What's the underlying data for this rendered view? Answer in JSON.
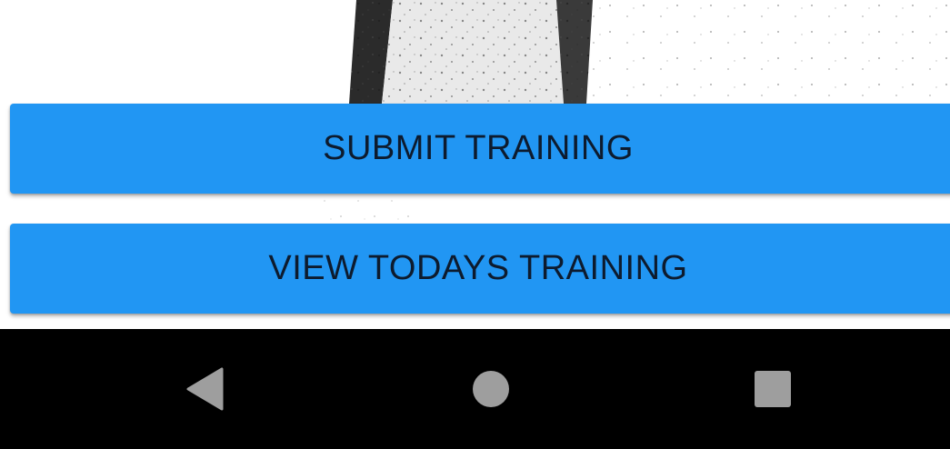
{
  "buttons": {
    "submit_training": "SUBMIT TRAINING",
    "view_todays_training": "VIEW TODAYS TRAINING"
  },
  "nav_bar": {
    "back_icon": "back-triangle-icon",
    "home_icon": "home-circle-icon",
    "recents_icon": "recents-square-icon"
  },
  "colors": {
    "button_bg": "#2196f3",
    "button_text": "#0d1b2e",
    "nav_bar_bg": "#000000",
    "nav_icon": "#9e9e9e"
  }
}
